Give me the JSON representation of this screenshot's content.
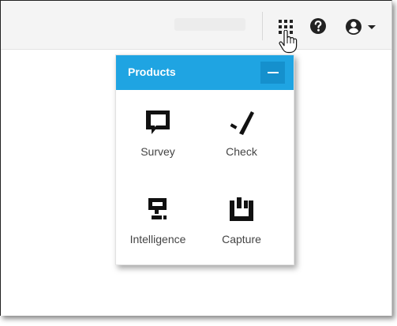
{
  "header": {
    "apps_icon": "grid-apps-icon",
    "help_icon": "help-circle-icon",
    "user_icon": "user-avatar-icon",
    "user_caret_icon": "caret-down-icon"
  },
  "products_panel": {
    "title": "Products",
    "collapse_icon": "minus-icon",
    "accent_color": "#1fa4e2",
    "items": [
      {
        "label": "Survey",
        "icon": "survey-icon"
      },
      {
        "label": "Check",
        "icon": "check-icon"
      },
      {
        "label": "Intelligence",
        "icon": "intelligence-icon"
      },
      {
        "label": "Capture",
        "icon": "capture-icon"
      }
    ]
  }
}
